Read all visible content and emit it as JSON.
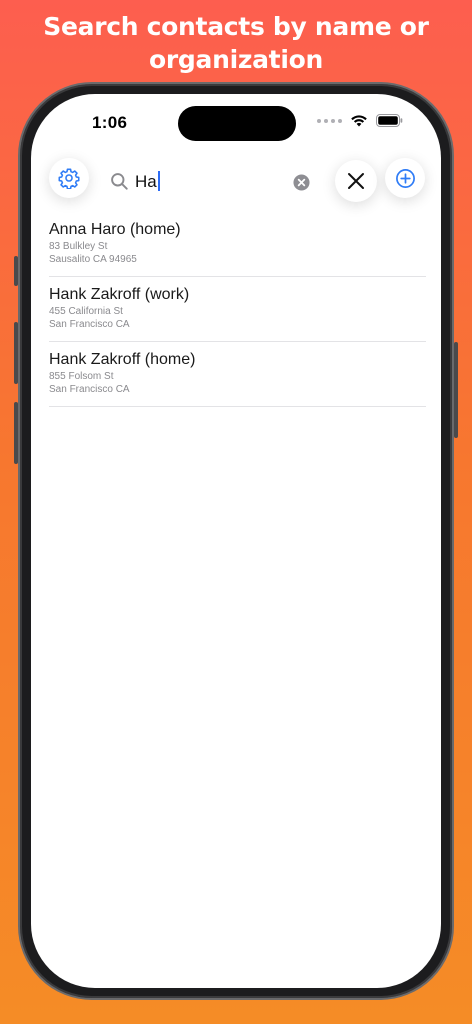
{
  "promo": {
    "line1": "Search contacts by name or",
    "line2": "organization"
  },
  "status_bar": {
    "time": "1:06"
  },
  "toolbar": {
    "settings_icon": "gear-icon",
    "search_icon": "magnifier-icon",
    "search_value": "Ha",
    "clear_icon": "clear-x-circle-icon",
    "close_icon": "close-x-icon",
    "add_icon": "plus-circle-icon"
  },
  "results": [
    {
      "name": "Anna Haro (home)",
      "street": "83 Bulkley St",
      "city": "Sausalito CA 94965"
    },
    {
      "name": "Hank Zakroff (work)",
      "street": "455 California St",
      "city": "San Francisco CA"
    },
    {
      "name": "Hank Zakroff (home)",
      "street": "855 Folsom St",
      "city": "San Francisco CA"
    }
  ],
  "colors": {
    "accent": "#2f7cf6",
    "gradient_top": "#fd5e4f",
    "gradient_bottom": "#f58c26"
  }
}
